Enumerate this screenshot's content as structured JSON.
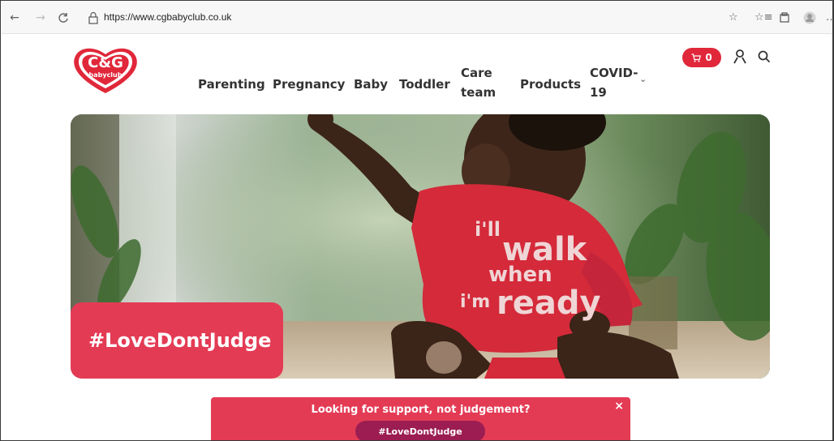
{
  "browser": {
    "url": "https://www.cgbabyclub.co.uk"
  },
  "site": {
    "logo_main": "C&G",
    "logo_sub": "babyclub",
    "nav": [
      {
        "label": "Parenting"
      },
      {
        "label": "Pregnancy"
      },
      {
        "label": "Baby"
      },
      {
        "label": "Toddler"
      },
      {
        "label_line1": "Care",
        "label_line2": "team"
      },
      {
        "label": "Products"
      },
      {
        "label_line1": "COVID-",
        "label_line2": "19"
      }
    ],
    "cart_count": "0",
    "brand_color": "#e0283a"
  },
  "hero": {
    "shirt_text_1": "i'll",
    "shirt_text_2": "walk",
    "shirt_text_3": "when",
    "shirt_text_4": "i'm",
    "shirt_text_5": "ready",
    "tag": "#LoveDontJudge"
  },
  "banner": {
    "title": "Looking for support, not judgement?",
    "button": "#LoveDontJudge",
    "close": "×"
  }
}
